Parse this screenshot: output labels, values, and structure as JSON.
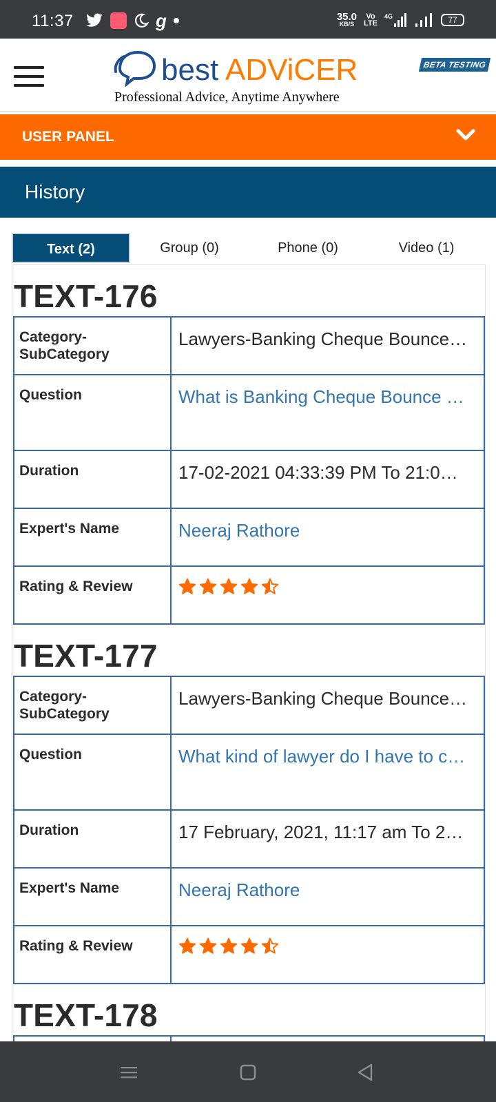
{
  "status_bar": {
    "time": "11:37",
    "speed": "35.0",
    "speed_unit": "KB/S",
    "volte_top": "Vo",
    "volte_bottom": "LTE",
    "network": "4G",
    "battery": "77"
  },
  "header": {
    "logo_word_1": "best",
    "logo_word_2": "ADViCER",
    "tagline": "Professional Advice, Anytime Anywhere",
    "beta_badge": "BETA TESTING"
  },
  "user_panel": {
    "label": "USER PANEL"
  },
  "history": {
    "title": "History"
  },
  "tabs": [
    {
      "label": "Text (2)",
      "active": true
    },
    {
      "label": "Group (0)",
      "active": false
    },
    {
      "label": "Phone (0)",
      "active": false
    },
    {
      "label": "Video (1)",
      "active": false
    }
  ],
  "labels": {
    "category": "Category-SubCategory",
    "question": "Question",
    "duration": "Duration",
    "expert": "Expert's Name",
    "rating": "Rating & Review"
  },
  "records": [
    {
      "id": "TEXT-176",
      "category": "Lawyers-Banking Cheque Bounce…",
      "question": "What is Banking Cheque Bounce …",
      "duration": "17-02-2021 04:33:39 PM To 21:0…",
      "expert": "Neeraj Rathore",
      "rating": 4.5
    },
    {
      "id": "TEXT-177",
      "category": "Lawyers-Banking Cheque Bounce…",
      "question": "What kind of lawyer do I have to c…",
      "duration": "17 February, 2021, 11:17 am To 2…",
      "expert": "Neeraj Rathore",
      "rating": 4.5
    },
    {
      "id": "TEXT-178"
    }
  ],
  "colors": {
    "orange": "#ff6a00",
    "navy": "#034d76",
    "table_border": "#3a69a8",
    "link": "#3275b0",
    "star": "#ff6a00"
  },
  "icons": {
    "menu": "hamburger-menu-icon",
    "chevron": "chevron-down-icon",
    "star": "star-icon",
    "nav_menu": "nav-menu-icon",
    "nav_home": "nav-home-icon",
    "nav_back": "nav-back-icon"
  }
}
